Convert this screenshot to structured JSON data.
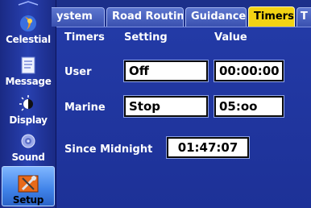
{
  "sidebar": {
    "items": [
      {
        "label": "Celestial"
      },
      {
        "label": "Message"
      },
      {
        "label": "Display"
      },
      {
        "label": "Sound"
      },
      {
        "label": "Setup"
      }
    ]
  },
  "tabs": [
    {
      "label": "ystem"
    },
    {
      "label": "Road Routing"
    },
    {
      "label": "Guidance"
    },
    {
      "label": "Timers"
    },
    {
      "label": "T"
    }
  ],
  "timers": {
    "headers": {
      "timers": "Timers",
      "setting": "Setting",
      "value": "Value"
    },
    "user": {
      "label": "User",
      "setting": "Off",
      "value": "00:00:00"
    },
    "marine": {
      "label": "Marine",
      "setting": "Stop",
      "value": "05:oo"
    },
    "since_midnight": {
      "label": "Since Midnight",
      "value": "01:47:07"
    }
  },
  "colors": {
    "active_tab": "#f3d313",
    "panel": "#233aa6",
    "field": "#ffffff"
  }
}
